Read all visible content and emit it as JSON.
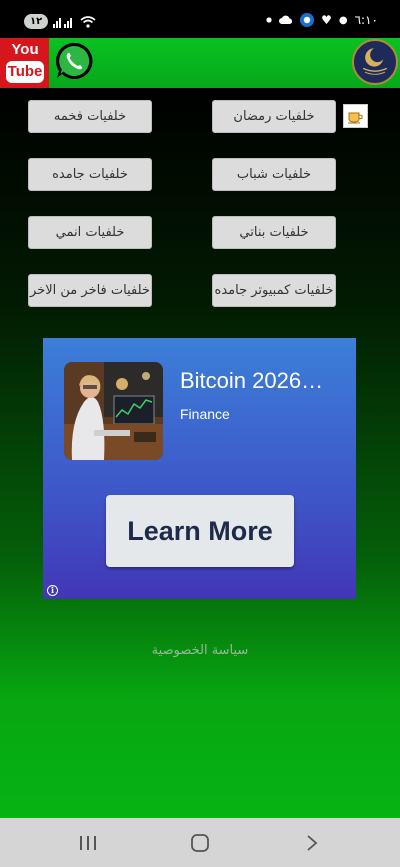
{
  "status_bar": {
    "battery_level": "١٢",
    "time": "٦:١٠"
  },
  "header": {
    "youtube_logo_top": "You",
    "youtube_logo_bottom": "Tube"
  },
  "categories": {
    "ramadan": "خلفيات رمضان",
    "luxury": "خلفيات فخمه",
    "youth": "خلفيات شباب",
    "static": "خلفيات جامده",
    "girls": "خلفيات بناتي",
    "anime": "خلفيات انمي",
    "computer": "خلفيات كمبيوتر جامده",
    "premium": "خلفيات فاخر من الاخر"
  },
  "ad": {
    "title": "Bitcoin 2026…",
    "subtitle": "Finance",
    "cta": "Learn More",
    "info_glyph": "i"
  },
  "footer": {
    "privacy_policy": "سياسة الخصوصية"
  },
  "colors": {
    "header_green": "#06a81a",
    "youtube_red": "#d7151c",
    "button_gray": "#dcdcdc",
    "ad_blue": "#3e56c8",
    "nav_gray": "#d5d5d5"
  }
}
